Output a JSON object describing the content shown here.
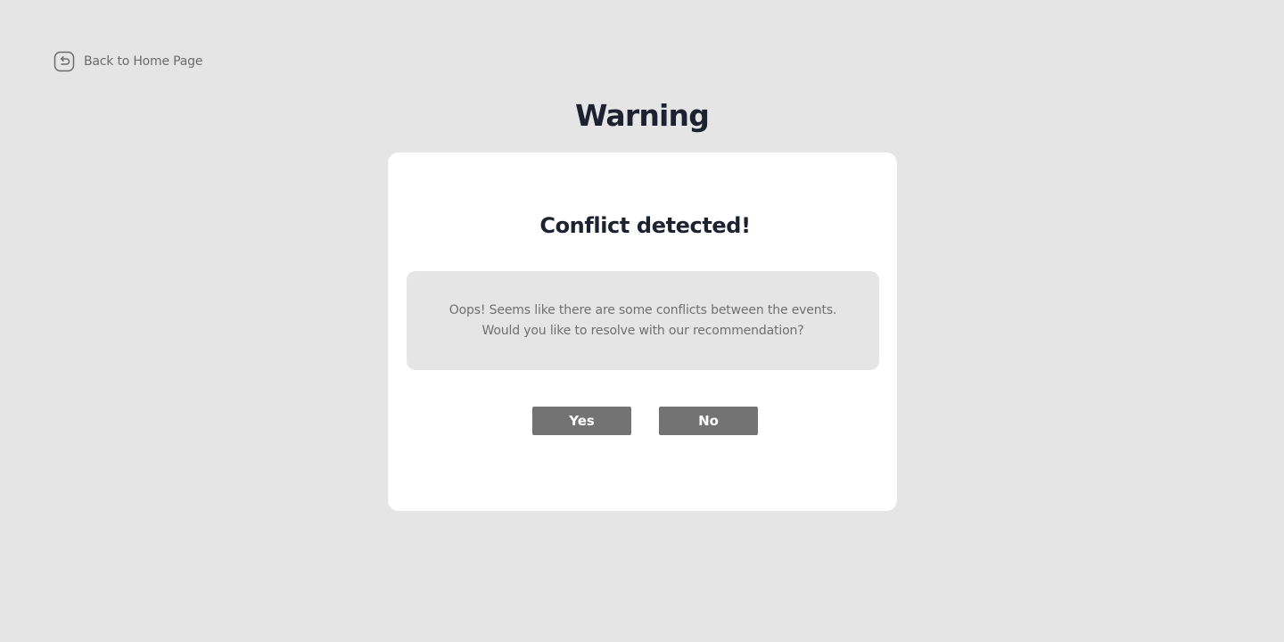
{
  "nav": {
    "back_label": "Back to Home Page",
    "back_icon": "back-arrow-icon"
  },
  "page": {
    "title": "Warning"
  },
  "dialog": {
    "title": "Conflict detected!",
    "message_lines": [
      "Oops! Seems like there are some conflicts between the events.",
      "Would you like to resolve with our recommendation?"
    ],
    "yes_label": "Yes",
    "no_label": "No"
  },
  "colors": {
    "background": "#e5e5e5",
    "card": "#ffffff",
    "title_text": "#1e2230",
    "muted_text": "#6b6b6b",
    "button": "#737373"
  }
}
